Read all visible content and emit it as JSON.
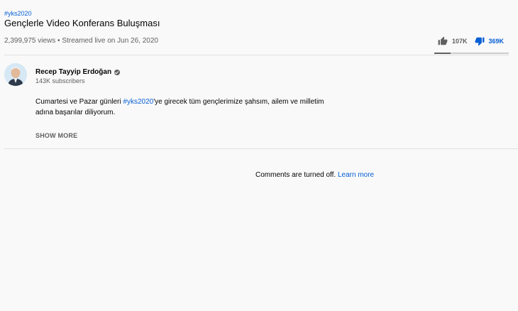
{
  "video": {
    "hashtag": "#yks2020",
    "title": "Gençlerle Video Konferans Buluşması",
    "meta": "2,399,975 views • Streamed live on Jun 26, 2020",
    "likes": "107K",
    "dislikes": "369K",
    "sentiment_like_fraction": 0.22
  },
  "channel": {
    "name": "Recep Tayyip Erdoğan",
    "subscribers": "143K subscribers",
    "verified_icon": "verified-check-icon"
  },
  "description": {
    "part1": "Cumartesi ve Pazar günleri ",
    "hashtag": "#yks2020",
    "part2": "'ye girecek tüm gençlerimize şahsım, ailem ve milletim adına başarılar diliyorum.",
    "show_more": "SHOW MORE"
  },
  "comments": {
    "text": "Comments are turned off.",
    "link": "Learn more"
  },
  "colors": {
    "link": "#065fd4",
    "secondary": "#606060",
    "background": "#f9f9f9"
  }
}
